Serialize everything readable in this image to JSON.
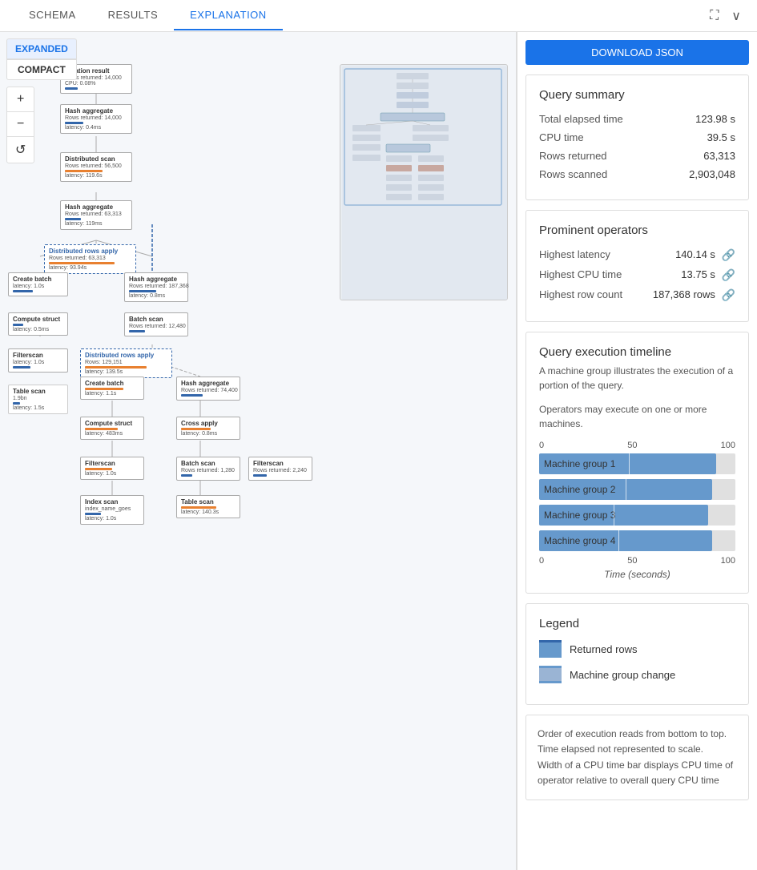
{
  "tabs": {
    "items": [
      {
        "label": "SCHEMA",
        "active": false
      },
      {
        "label": "RESULTS",
        "active": false
      },
      {
        "label": "EXPLANATION",
        "active": true
      }
    ]
  },
  "toolbar": {
    "download_label": "DOWNLOAD JSON",
    "expanded_label": "EXPANDED",
    "compact_label": "COMPACT"
  },
  "zoom": {
    "plus": "+",
    "minus": "−",
    "reset": "↺"
  },
  "query_summary": {
    "title": "Query summary",
    "rows": [
      {
        "label": "Total elapsed time",
        "value": "123.98 s"
      },
      {
        "label": "CPU time",
        "value": "39.5 s"
      },
      {
        "label": "Rows returned",
        "value": "63,313"
      },
      {
        "label": "Rows scanned",
        "value": "2,903,048"
      }
    ]
  },
  "prominent_operators": {
    "title": "Prominent operators",
    "rows": [
      {
        "label": "Highest latency",
        "value": "140.14 s",
        "has_link": true
      },
      {
        "label": "Highest CPU time",
        "value": "13.75 s",
        "has_link": true
      },
      {
        "label": "Highest row count",
        "value": "187,368 rows",
        "has_link": true
      }
    ]
  },
  "timeline": {
    "title": "Query execution timeline",
    "description1": "A machine group illustrates the execution of a portion of the query.",
    "description2": "Operators may execute on one or more machines.",
    "axis_min": "0",
    "axis_mid": "50",
    "axis_max": "100",
    "bars": [
      {
        "label": "Machine group 1",
        "fill_pct": 90,
        "tick_pct": 46
      },
      {
        "label": "Machine group 2",
        "fill_pct": 88,
        "tick_pct": 44
      },
      {
        "label": "Machine group 3",
        "fill_pct": 86,
        "tick_pct": 38
      },
      {
        "label": "Machine group 4",
        "fill_pct": 88,
        "tick_pct": 40
      }
    ],
    "bottom_labels": [
      "0",
      "50",
      "100"
    ],
    "x_axis_title": "Time (seconds)"
  },
  "legend": {
    "title": "Legend",
    "items": [
      {
        "type": "returned",
        "label": "Returned rows"
      },
      {
        "type": "machine",
        "label": "Machine group change"
      }
    ]
  },
  "notes": {
    "lines": [
      "Order of execution reads from bottom to top.",
      "Time elapsed not represented to scale.",
      "Width of a CPU time bar displays CPU time of operator relative to overall query CPU time"
    ]
  }
}
